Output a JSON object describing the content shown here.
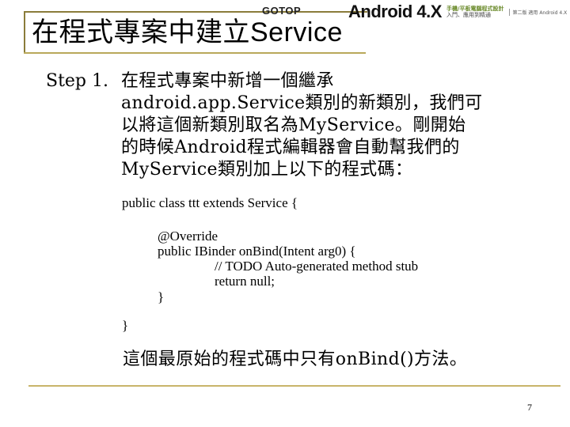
{
  "header": {
    "title_cjk": "在程式專案中建立",
    "title_latin": "Service",
    "publisher_logo": "GOTOP",
    "book_logo": "Android 4.X",
    "book_subtitle_top": "手機/平板電腦程式設計",
    "book_subtitle_bottom": "入門、應用到精通",
    "book_series": "第二版 適用 Android 4.X"
  },
  "step": {
    "label": "Step 1.",
    "lines": [
      "在程式專案中新增一個繼承",
      "android.app.Service類別的新類別，我們可",
      "以將這個新類別取名為MyService。剛開始",
      "的時候Android程式編輯器會自動幫我們的",
      "MyService類別加上以下的程式碼："
    ]
  },
  "code": {
    "lines": [
      "public class ttt extends Service {",
      "@Override",
      "public IBinder onBind(Intent arg0) {",
      "// TODO Auto-generated method stub",
      "return null;",
      "}",
      "}"
    ]
  },
  "summary": "這個最原始的程式碼中只有onBind()方法。",
  "page_number": "7",
  "colors": {
    "title_rule": "#b9a85a",
    "title_border": "#8a7c3a",
    "footer_rule": "#c8b46a"
  }
}
